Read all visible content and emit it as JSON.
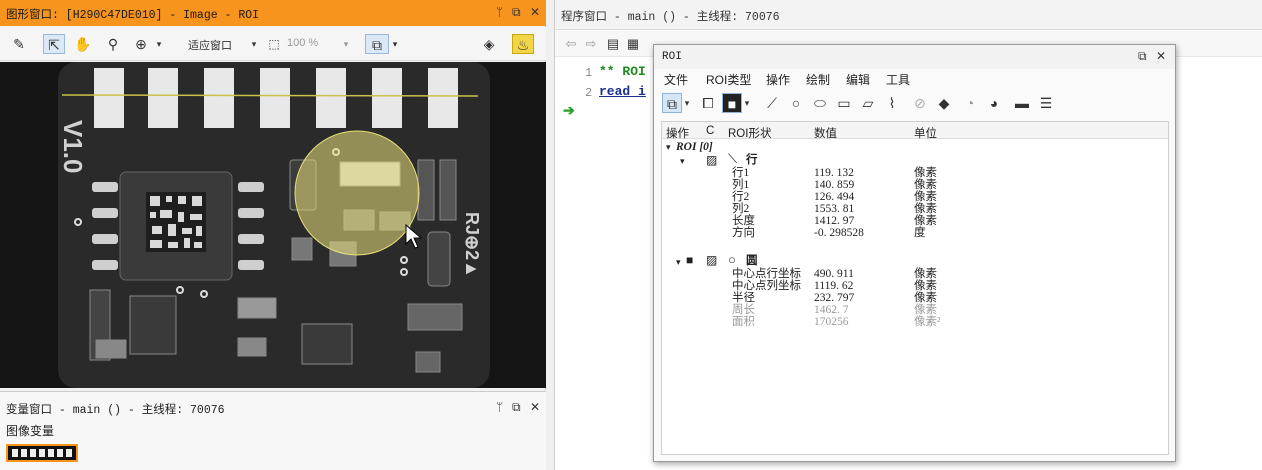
{
  "graphics_window": {
    "title": "图形窗口: [H290C47DE010] - Image - ROI",
    "toolbar": {
      "fit_label": "适应窗口",
      "zoom_label": "100 %"
    }
  },
  "variable_window": {
    "title": "变量窗口 - main () - 主线程: 70076",
    "section_label": "图像变量"
  },
  "program_window": {
    "title": "程序窗口 - main () - 主线程: 70076",
    "lines": [
      {
        "num": "1",
        "text": "** ROI"
      },
      {
        "num": "2",
        "text": "read_i"
      }
    ]
  },
  "roi_dialog": {
    "title": "ROI",
    "menu": [
      "文件",
      "ROI类型",
      "操作",
      "绘制",
      "编辑",
      "工具"
    ],
    "columns": [
      "操作",
      "C",
      "ROI形状",
      "数值",
      "单位"
    ],
    "root_label": "ROI [0]",
    "line_shape": {
      "label": "行",
      "rows": [
        {
          "name": "行1",
          "value": "119. 132",
          "unit": "像素"
        },
        {
          "name": "列1",
          "value": "140. 859",
          "unit": "像素"
        },
        {
          "name": "行2",
          "value": "126. 494",
          "unit": "像素"
        },
        {
          "name": "列2",
          "value": "1553. 81",
          "unit": "像素"
        },
        {
          "name": "长度",
          "value": "1412. 97",
          "unit": "像素"
        },
        {
          "name": "方向",
          "value": "-0. 298528",
          "unit": "度"
        }
      ]
    },
    "circle_shape": {
      "label": "圆",
      "rows": [
        {
          "name": "中心点行坐标",
          "value": "490. 911",
          "unit": "像素"
        },
        {
          "name": "中心点列坐标",
          "value": "1119. 62",
          "unit": "像素"
        },
        {
          "name": "半径",
          "value": "232. 797",
          "unit": "像素"
        }
      ],
      "derived_rows": [
        {
          "name": "周长",
          "value": "1462. 7",
          "unit": "像素"
        },
        {
          "name": "面积",
          "value": "170256",
          "unit": "像素²"
        }
      ]
    }
  },
  "colors": {
    "accent_orange": "#f7941d",
    "roi_circle_fill": "#e8e07a",
    "roi_line": "#c9c24a",
    "arrow_green": "#2aa02a"
  },
  "pcb_labels": {
    "version": "V1.0",
    "marks": "RJ⊕2▲"
  }
}
